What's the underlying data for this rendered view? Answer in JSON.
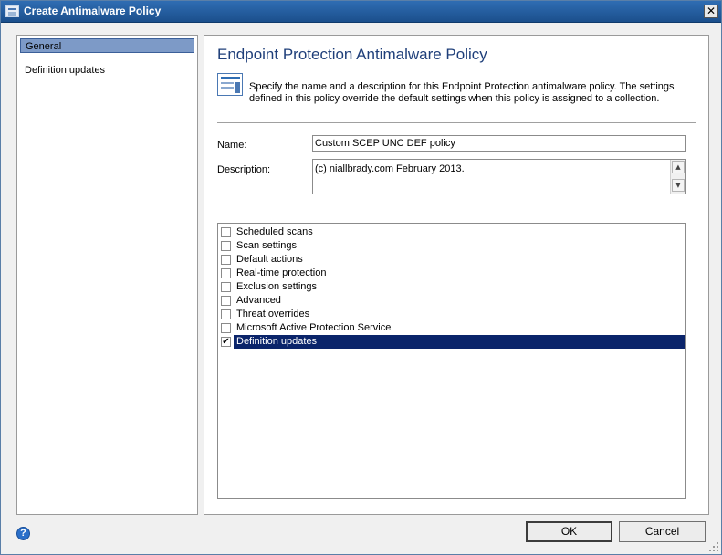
{
  "window": {
    "title": "Create Antimalware Policy",
    "close_glyph": "✕"
  },
  "nav": {
    "items": [
      {
        "label": "General",
        "selected": true
      },
      {
        "label": "Definition updates",
        "selected": false
      }
    ]
  },
  "main": {
    "title": "Endpoint Protection Antimalware Policy",
    "description": "Specify the name and a description for this Endpoint Protection antimalware policy. The settings defined in this policy override the default settings when this policy is assigned to a collection.",
    "name_label": "Name:",
    "name_value": "Custom SCEP UNC DEF policy",
    "description_label": "Description:",
    "description_value": "(c) niallbrady.com February 2013.",
    "settings": [
      {
        "label": "Scheduled scans",
        "checked": false
      },
      {
        "label": "Scan settings",
        "checked": false
      },
      {
        "label": "Default actions",
        "checked": false
      },
      {
        "label": "Real-time protection",
        "checked": false
      },
      {
        "label": "Exclusion settings",
        "checked": false
      },
      {
        "label": "Advanced",
        "checked": false
      },
      {
        "label": "Threat overrides",
        "checked": false
      },
      {
        "label": "Microsoft Active Protection Service",
        "checked": false
      },
      {
        "label": "Definition updates",
        "checked": true,
        "selected": true
      }
    ]
  },
  "footer": {
    "ok_label": "OK",
    "cancel_label": "Cancel",
    "help_glyph": "?"
  },
  "colors": {
    "titlebar": "#1b4f8c",
    "selection": "#0a246a",
    "nav_selection": "#7d9ac7",
    "heading": "#1f3f7a"
  },
  "icons": [
    "app-icon",
    "close-icon",
    "policy-info-icon",
    "scroll-up-icon",
    "scroll-down-icon",
    "checkbox",
    "help-icon"
  ]
}
